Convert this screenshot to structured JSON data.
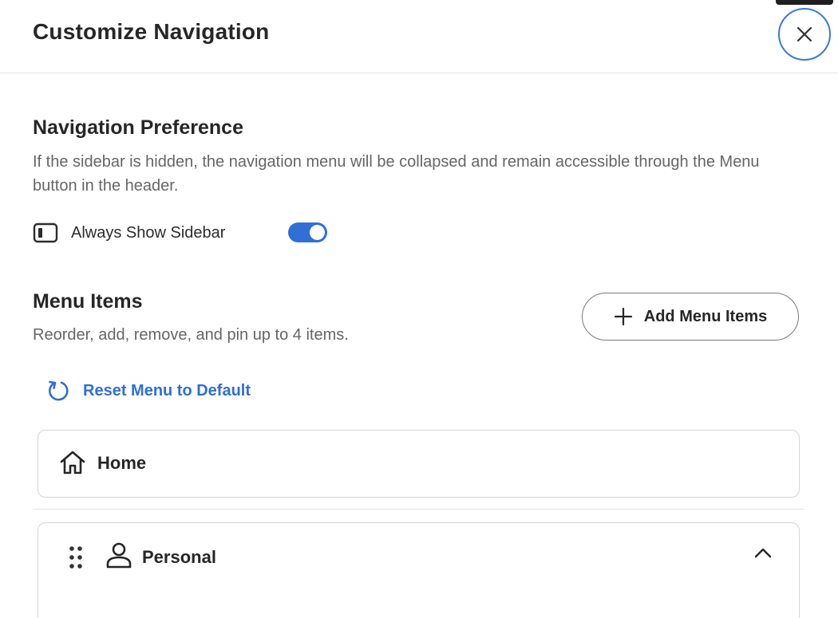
{
  "header": {
    "title": "Customize Navigation"
  },
  "navigation_preference": {
    "title": "Navigation Preference",
    "description": "If the sidebar is hidden, the navigation menu will be collapsed and remain accessible through the Menu button in the header.",
    "always_show_sidebar": {
      "label": "Always Show Sidebar",
      "icon": "sidebar-icon",
      "enabled": true
    }
  },
  "menu_items": {
    "title": "Menu Items",
    "description": "Reorder, add, remove, and pin up to 4 items.",
    "add_button_label": "Add Menu Items",
    "reset_label": "Reset Menu to Default",
    "items": [
      {
        "label": "Home",
        "icon": "home-icon"
      },
      {
        "label": "Personal",
        "icon": "person-icon"
      }
    ]
  },
  "colors": {
    "accent": "#2f6fd6",
    "focus_ring": "#3b7ad9"
  }
}
